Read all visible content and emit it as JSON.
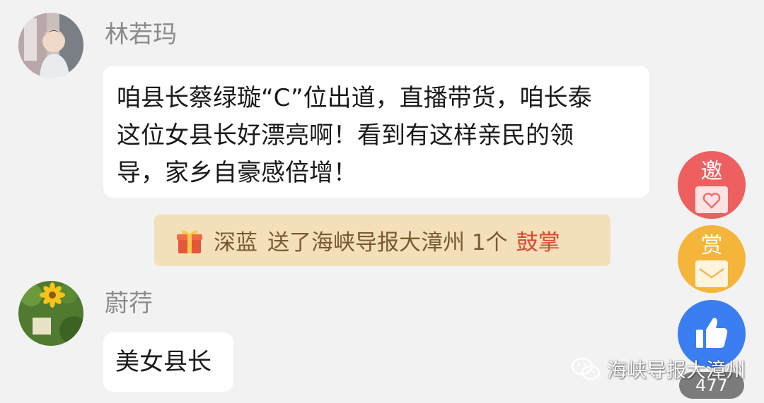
{
  "comments": [
    {
      "username": "林若玛",
      "text_lines": [
        "咱县长蔡绿璇“C”位出道，直播带货，咱长泰",
        "这位女县长好漂亮啊！看到有这样亲民的领",
        "导，家乡自豪感倍增！"
      ]
    },
    {
      "username": "蔚荇",
      "text": "美女县长"
    }
  ],
  "gift_notice": {
    "icon": "gift-box-icon",
    "sender": "深蓝",
    "text": "送了海峡导报大漳州 1个",
    "gift_name": "鼓掌"
  },
  "float_buttons": {
    "invite_label": "邀",
    "reward_label": "赏",
    "like_icon": "thumbs-up-icon",
    "like_count": "477"
  },
  "watermark": {
    "icon": "wechat-icon",
    "text": "海峡导报大漳州"
  },
  "colors": {
    "background": "#f2f2f2",
    "gift_banner": "#f3dfb9",
    "gift_name": "#d8482f",
    "invite": "#ee5f60",
    "reward": "#f4b53a",
    "like": "#3b7ef2"
  }
}
